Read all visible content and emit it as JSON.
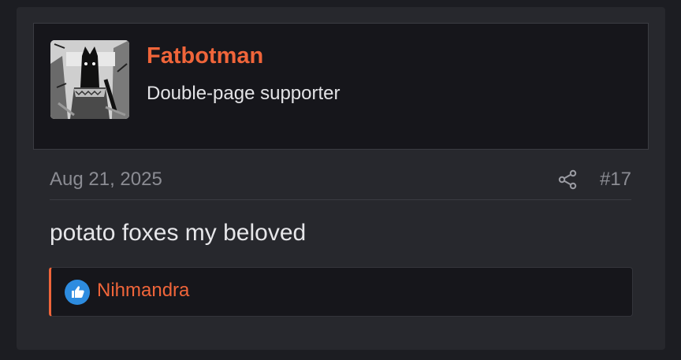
{
  "user": {
    "name": "Fatbotman",
    "title": "Double-page supporter",
    "avatar_icon": "avatar-image"
  },
  "post": {
    "date": "Aug 21, 2025",
    "number": "#17",
    "body": "potato foxes my beloved",
    "share_icon": "share-icon"
  },
  "reactions": {
    "icon": "like-icon",
    "users": "Nihmandra"
  },
  "colors": {
    "accent": "#f0653a",
    "like_blue": "#2d8ce0",
    "post_bg": "#27282d",
    "block_bg": "#16161b"
  }
}
